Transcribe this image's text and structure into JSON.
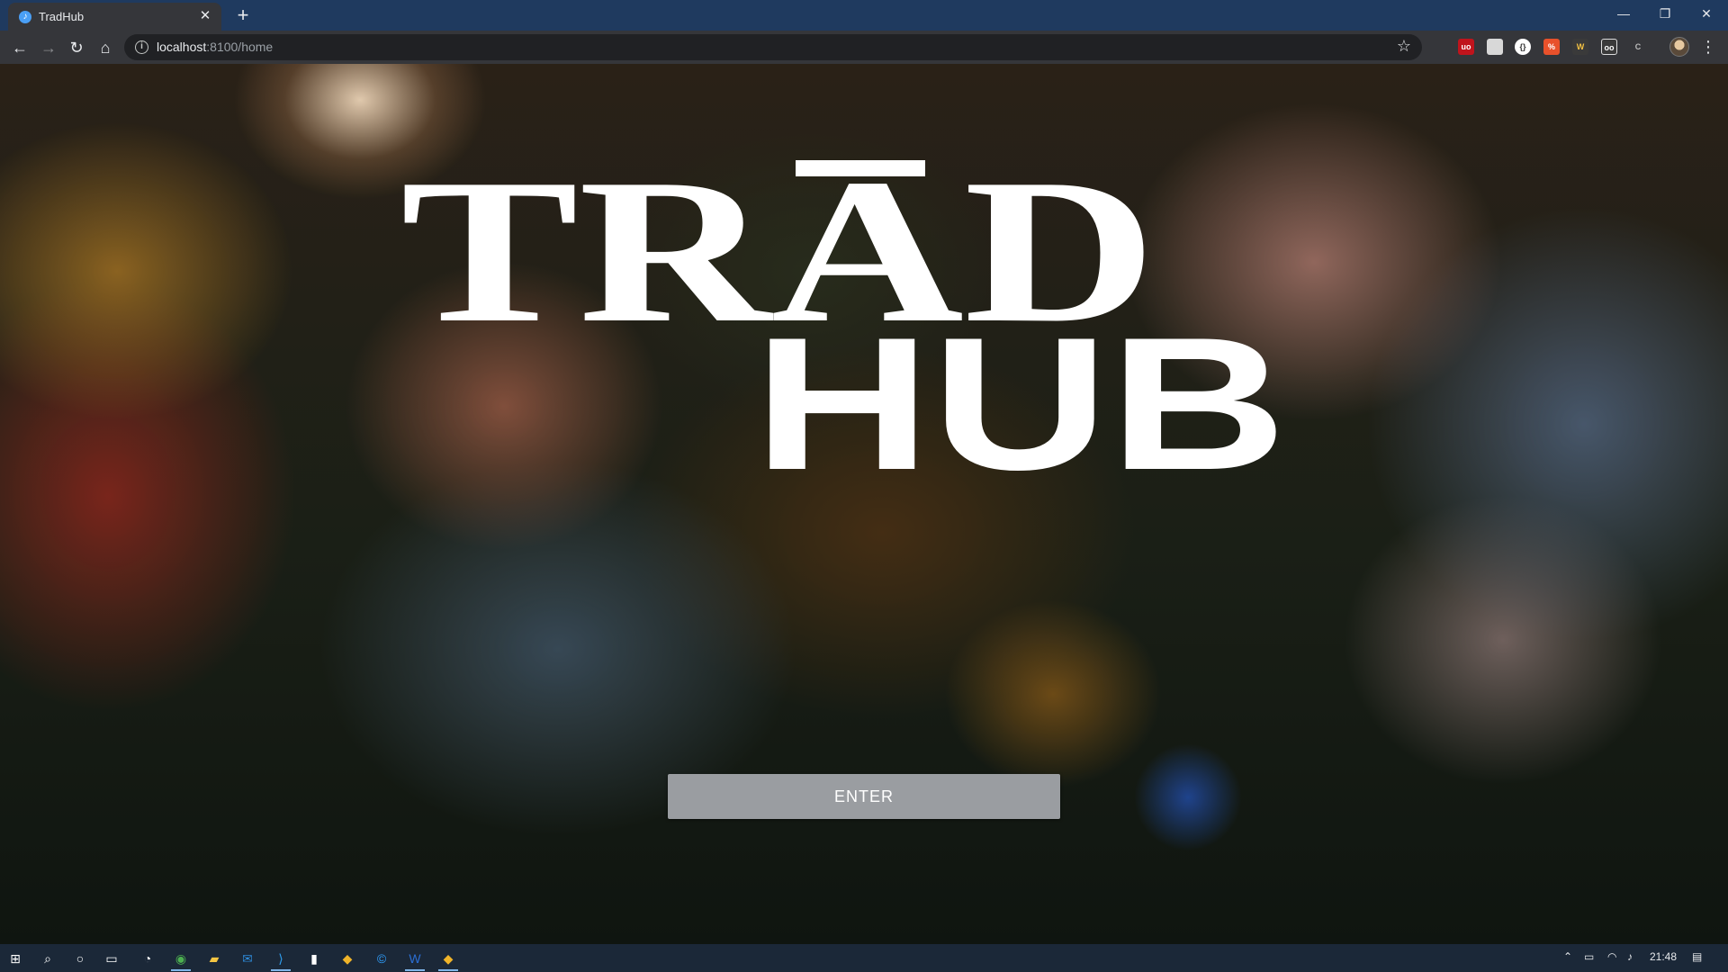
{
  "browser": {
    "tab_title": "TradHub",
    "new_tab_label": "+",
    "url_host": "localhost",
    "url_path": ":8100/home",
    "window_controls": {
      "minimize": "—",
      "restore": "❐",
      "close": "✕"
    }
  },
  "page": {
    "logo_line1": "TRAD",
    "logo_line2": "HUB",
    "enter_label": "ENTER"
  },
  "taskbar": {
    "clock": "21:48"
  },
  "colors": {
    "tabstrip": "#1f3a5f",
    "toolbar": "#35363a",
    "button": "#9a9da1",
    "taskbar": "#1b2838"
  }
}
